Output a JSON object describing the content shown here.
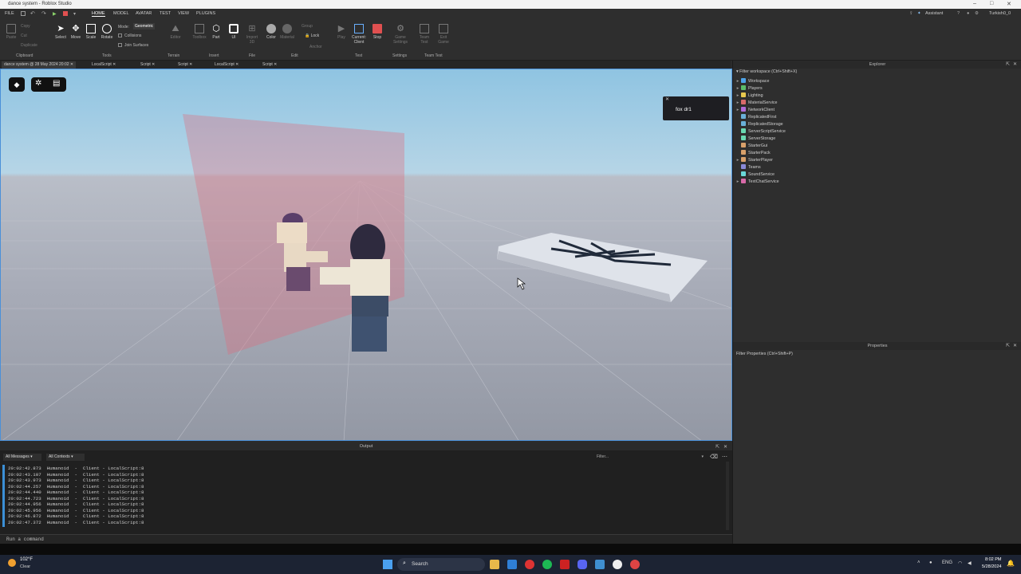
{
  "window": {
    "title": "dance system - Roblox Studio",
    "controls": [
      "–",
      "□",
      "✕"
    ]
  },
  "menubar": {
    "items": [
      "FILE",
      "HOME",
      "MODEL",
      "AVATAR",
      "TEST",
      "VIEW",
      "PLUGINS"
    ],
    "right": {
      "assistant": "Assistant",
      "user": "Turkish0_0"
    }
  },
  "ribbon": {
    "clipboard": {
      "paste": "Paste",
      "copy": "Copy",
      "cut": "Cut",
      "duplicate": "Duplicate",
      "group": "Clipboard"
    },
    "tools": {
      "select": "Select",
      "move": "Move",
      "scale": "Scale",
      "rotate": "Rotate",
      "group": "Tools"
    },
    "mode": {
      "label": "Mode:",
      "value": "Geometric",
      "collisions": "Collisions",
      "join": "Join Surfaces"
    },
    "terrain": {
      "editor": "Editor",
      "group": "Terrain"
    },
    "insert": {
      "toolbox": "Toolbox",
      "part": "Part",
      "ui": "UI",
      "group": "Insert"
    },
    "file": {
      "import": "Import 3D",
      "group": "File"
    },
    "edit": {
      "color": "Color",
      "material": "Material",
      "groupbtn": "Group",
      "lock": "Lock",
      "anchor": "Anchor",
      "group": "Edit"
    },
    "test": {
      "play": "Play",
      "client": "Current: Client",
      "stop": "Stop",
      "group": "Test"
    },
    "settings": {
      "game": "Game Settings",
      "group": "Settings"
    },
    "teamtest": {
      "team": "Team Test",
      "exit": "Exit Game",
      "group": "Team Test"
    }
  },
  "tabs": [
    "dance system @ 28 May 2024 20:02",
    "LocalScript",
    "Script",
    "Script",
    "LocalScript",
    "Script"
  ],
  "viewport": {
    "popup": "fox dr1",
    "cursor": "arrow"
  },
  "output": {
    "title": "Output",
    "filter_messages": "All Messages",
    "filter_contexts": "All Contexts",
    "filter_placeholder": "Filter...",
    "lines": [
      "20:02:42.873  Humanoid  -  Client - LocalScript:8",
      "20:02:43.107  Humanoid  -  Client - LocalScript:8",
      "20:02:43.973  Humanoid  -  Client - LocalScript:8",
      "20:02:44.257  Humanoid  -  Client - LocalScript:8",
      "20:02:44.440  Humanoid  -  Client - LocalScript:8",
      "20:02:44.723  Humanoid  -  Client - LocalScript:8",
      "20:02:44.956  Humanoid  -  Client - LocalScript:8",
      "20:02:45.956  Humanoid  -  Client - LocalScript:8",
      "20:02:46.872  Humanoid  -  Client - LocalScript:8",
      "20:02:47.372  Humanoid  -  Client - LocalScript:8"
    ]
  },
  "command": {
    "placeholder": "Run a command"
  },
  "explorer": {
    "title": "Explorer",
    "filter": "Filter workspace (Ctrl+Shift+X)",
    "items": [
      {
        "label": "Workspace",
        "expandable": true,
        "color": "#4ea3e8"
      },
      {
        "label": "Players",
        "expandable": true,
        "color": "#5bbd6a"
      },
      {
        "label": "Lighting",
        "expandable": true,
        "color": "#e8c84e"
      },
      {
        "label": "MaterialService",
        "expandable": true,
        "color": "#d86a6a"
      },
      {
        "label": "NetworkClient",
        "expandable": true,
        "color": "#b06ad8"
      },
      {
        "label": "ReplicatedFirst",
        "expandable": false,
        "color": "#6ab0d8"
      },
      {
        "label": "ReplicatedStorage",
        "expandable": false,
        "color": "#6ab0d8"
      },
      {
        "label": "ServerScriptService",
        "expandable": false,
        "color": "#6ad8b0"
      },
      {
        "label": "ServerStorage",
        "expandable": false,
        "color": "#6ad8b0"
      },
      {
        "label": "StarterGui",
        "expandable": false,
        "color": "#d8a06a"
      },
      {
        "label": "StarterPack",
        "expandable": false,
        "color": "#d8a06a"
      },
      {
        "label": "StarterPlayer",
        "expandable": true,
        "color": "#d8a06a"
      },
      {
        "label": "Teams",
        "expandable": false,
        "color": "#8a8ad8"
      },
      {
        "label": "SoundService",
        "expandable": false,
        "color": "#6ad8d8"
      },
      {
        "label": "TextChatService",
        "expandable": true,
        "color": "#d86aa8"
      }
    ]
  },
  "properties": {
    "title": "Properties",
    "filter": "Filter Properties (Ctrl+Shift+P)"
  },
  "taskbar": {
    "weather_temp": "102°F",
    "weather_desc": "Clear",
    "search": "Search",
    "lang": "ENG",
    "time": "8:02 PM",
    "date": "5/28/2024"
  }
}
